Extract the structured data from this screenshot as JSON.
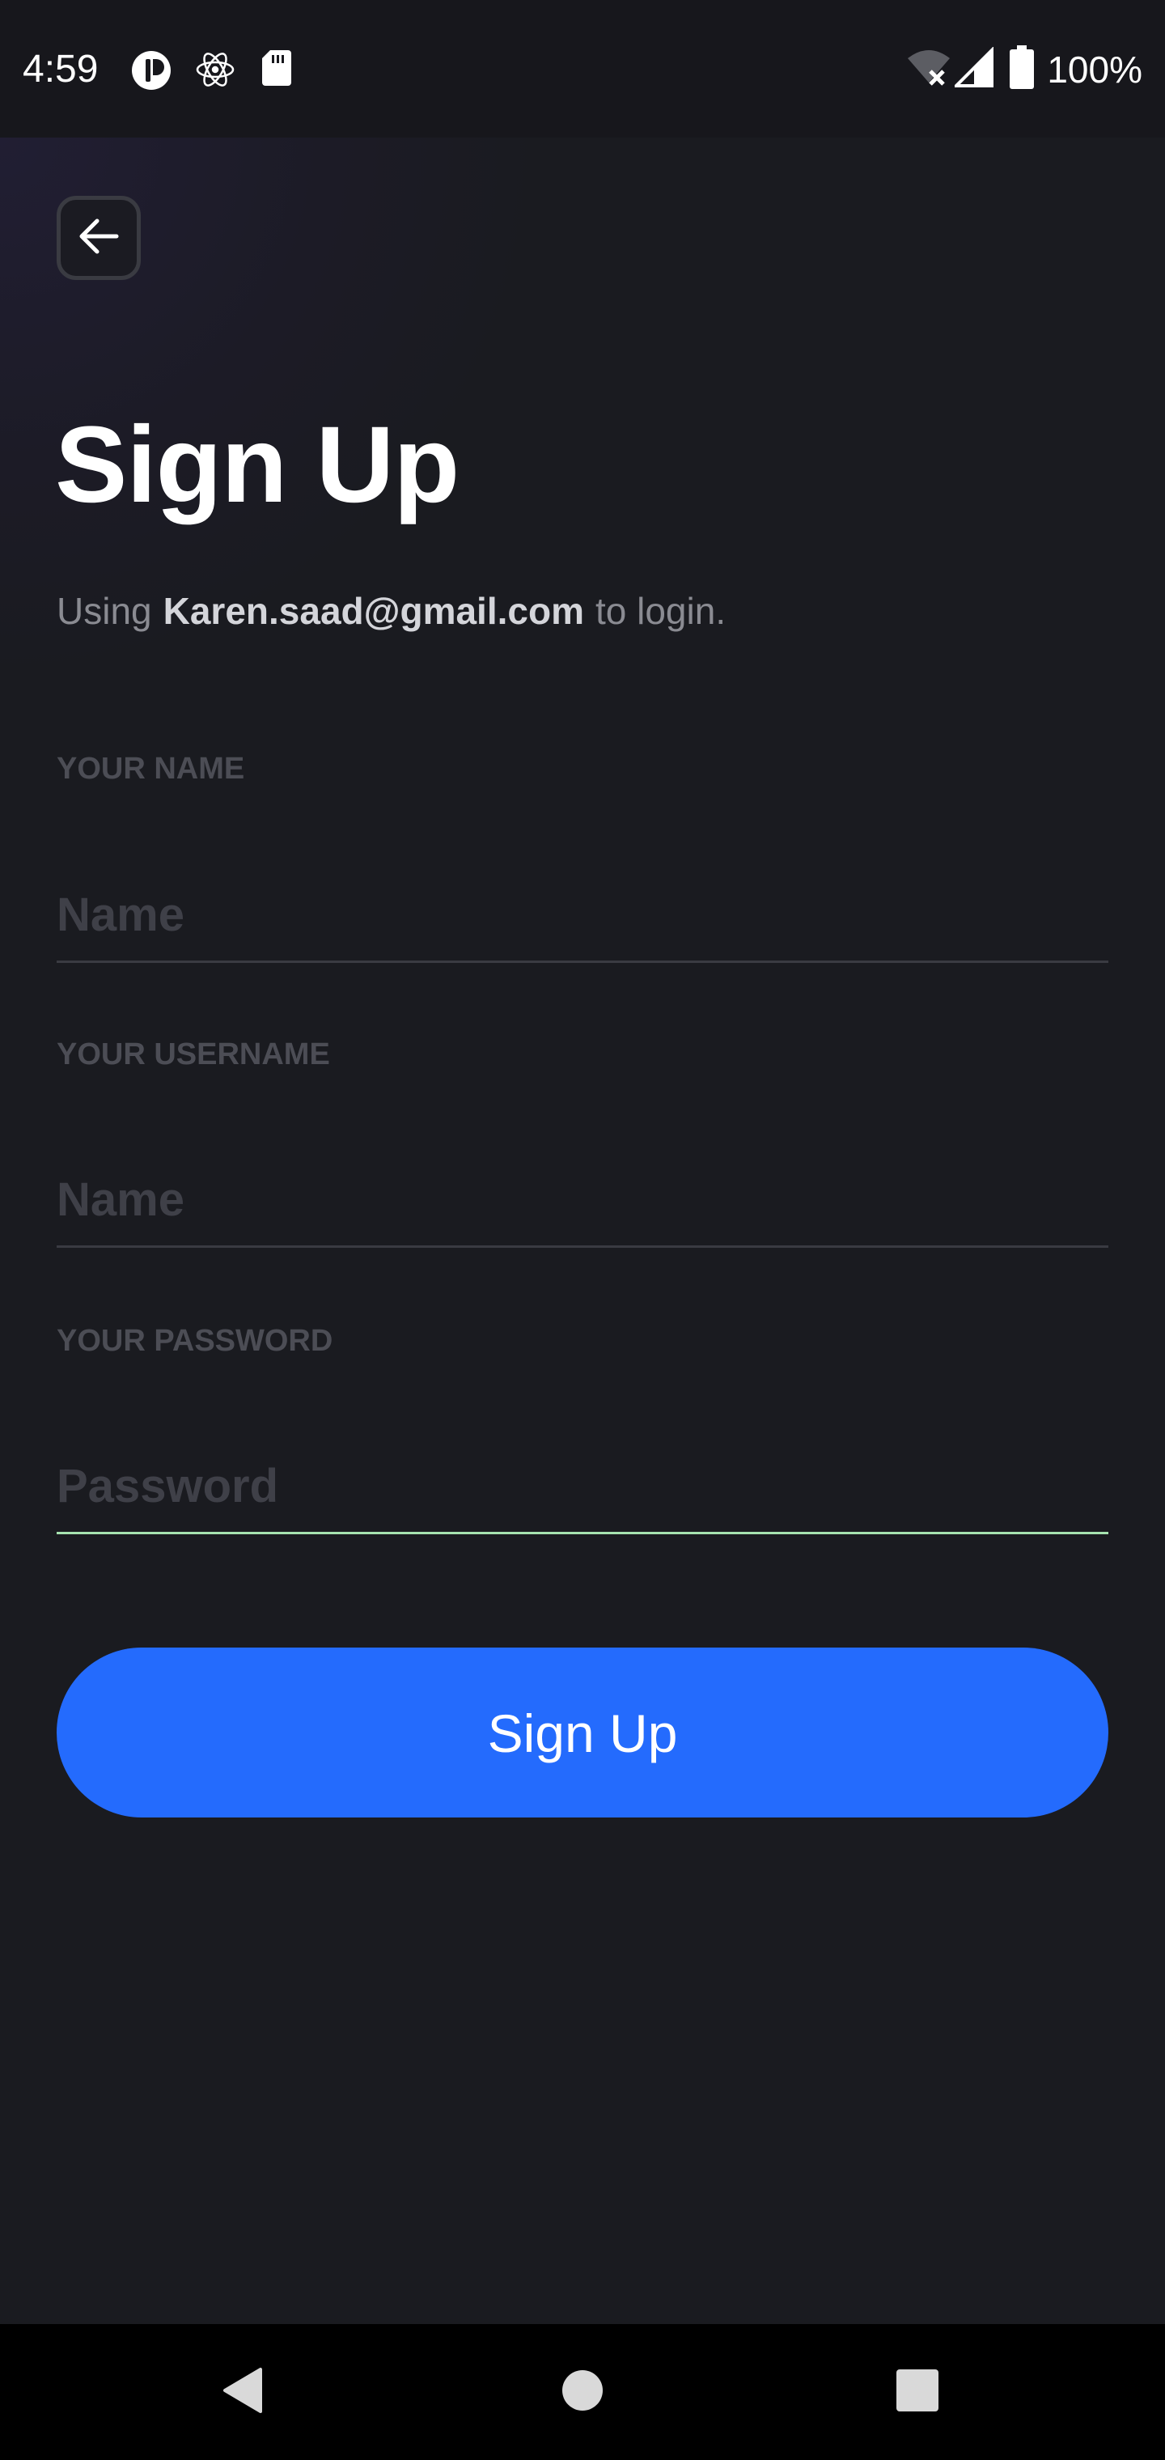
{
  "status_bar": {
    "time": "4:59",
    "icons_left": [
      "app-notification-icon",
      "react-icon",
      "sd-card-icon"
    ],
    "icons_right": [
      "wifi-off-icon",
      "signal-icon",
      "battery-icon"
    ],
    "battery_text": "100%"
  },
  "header": {
    "back_icon": "arrow-left-icon",
    "title": "Sign Up"
  },
  "subtitle": {
    "prefix": "Using",
    "email": "Karen.saad@gmail.com",
    "suffix": "to login."
  },
  "form": {
    "name": {
      "label": "YOUR NAME",
      "placeholder": "Name",
      "value": ""
    },
    "username": {
      "label": "YOUR USERNAME",
      "placeholder": "Name",
      "value": ""
    },
    "password": {
      "label": "YOUR PASSWORD",
      "placeholder": "Password",
      "value": ""
    },
    "submit_label": "Sign Up"
  },
  "nav_bar": {
    "buttons": [
      "back-triangle-icon",
      "home-circle-icon",
      "recents-square-icon"
    ]
  },
  "colors": {
    "background": "#1a1b20",
    "accent": "#246bfd",
    "active_underline": "#a6e3b0",
    "muted_text": "#8a8b92"
  }
}
